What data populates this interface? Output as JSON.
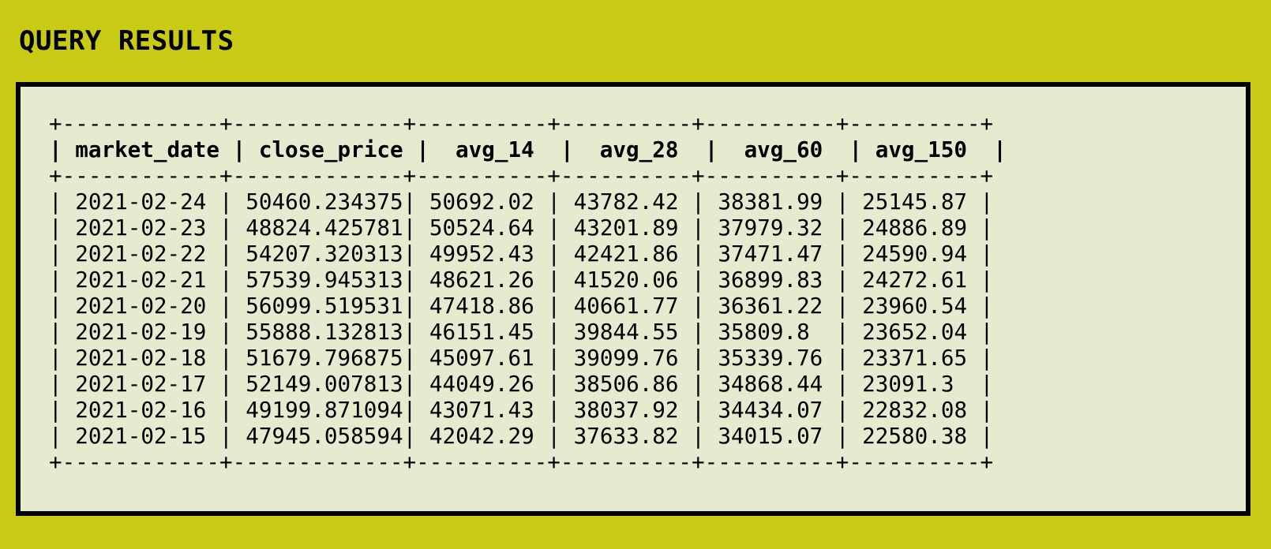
{
  "page": {
    "title": "QUERY RESULTS"
  },
  "table": {
    "columns": [
      {
        "key": "market_date",
        "label": "market_date"
      },
      {
        "key": "close_price",
        "label": "close_price"
      },
      {
        "key": "avg_14",
        "label": "avg_14"
      },
      {
        "key": "avg_28",
        "label": "avg_28"
      },
      {
        "key": "avg_60",
        "label": "avg_60"
      },
      {
        "key": "avg_150",
        "label": "avg_150"
      }
    ],
    "rows": [
      {
        "market_date": "2021-02-24",
        "close_price": "50460.234375",
        "avg_14": "50692.02",
        "avg_28": "43782.42",
        "avg_60": "38381.99",
        "avg_150": "25145.87"
      },
      {
        "market_date": "2021-02-23",
        "close_price": "48824.425781",
        "avg_14": "50524.64",
        "avg_28": "43201.89",
        "avg_60": "37979.32",
        "avg_150": "24886.89"
      },
      {
        "market_date": "2021-02-22",
        "close_price": "54207.320313",
        "avg_14": "49952.43",
        "avg_28": "42421.86",
        "avg_60": "37471.47",
        "avg_150": "24590.94"
      },
      {
        "market_date": "2021-02-21",
        "close_price": "57539.945313",
        "avg_14": "48621.26",
        "avg_28": "41520.06",
        "avg_60": "36899.83",
        "avg_150": "24272.61"
      },
      {
        "market_date": "2021-02-20",
        "close_price": "56099.519531",
        "avg_14": "47418.86",
        "avg_28": "40661.77",
        "avg_60": "36361.22",
        "avg_150": "23960.54"
      },
      {
        "market_date": "2021-02-19",
        "close_price": "55888.132813",
        "avg_14": "46151.45",
        "avg_28": "39844.55",
        "avg_60": "35809.8",
        "avg_150": "23652.04"
      },
      {
        "market_date": "2021-02-18",
        "close_price": "51679.796875",
        "avg_14": "45097.61",
        "avg_28": "39099.76",
        "avg_60": "35339.76",
        "avg_150": "23371.65"
      },
      {
        "market_date": "2021-02-17",
        "close_price": "52149.007813",
        "avg_14": "44049.26",
        "avg_28": "38506.86",
        "avg_60": "34868.44",
        "avg_150": "23091.3"
      },
      {
        "market_date": "2021-02-16",
        "close_price": "49199.871094",
        "avg_14": "43071.43",
        "avg_28": "38037.92",
        "avg_60": "34434.07",
        "avg_150": "22832.08"
      },
      {
        "market_date": "2021-02-15",
        "close_price": "47945.058594",
        "avg_14": "42042.29",
        "avg_28": "37633.82",
        "avg_60": "34015.07",
        "avg_150": "22580.38"
      }
    ]
  }
}
